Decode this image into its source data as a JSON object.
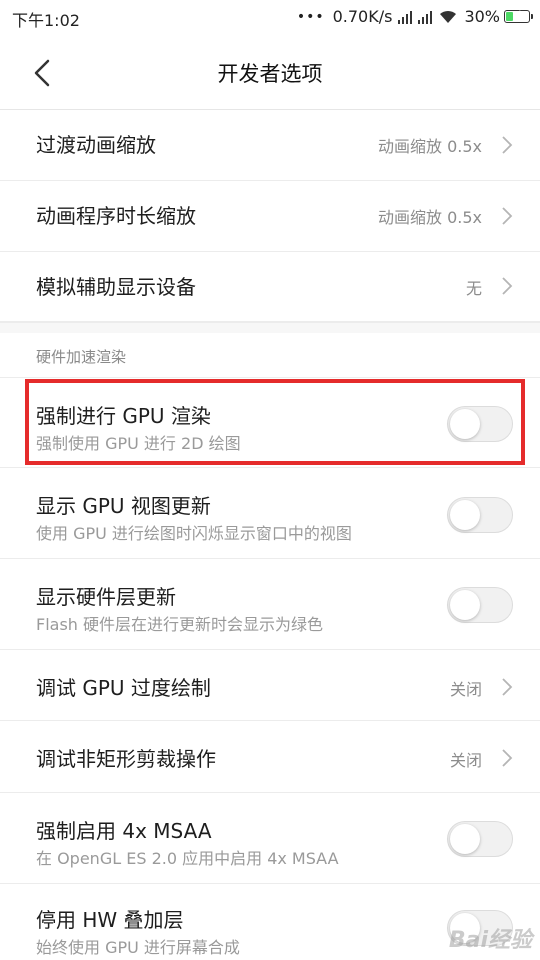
{
  "status": {
    "time": "下午1:02",
    "dots": "•••",
    "network_speed": "0.70K/s",
    "battery": "30%",
    "battery_level": 0.3,
    "battery_fill_color": "#4cd964"
  },
  "header": {
    "title": "开发者选项",
    "back_icon": "chevron-left-icon"
  },
  "rows_top": [
    {
      "title": "过渡动画缩放",
      "value": "动画缩放 0.5x"
    },
    {
      "title": "动画程序时长缩放",
      "value": "动画缩放 0.5x"
    },
    {
      "title": "模拟辅助显示设备",
      "value": "无"
    }
  ],
  "section": {
    "label": "硬件加速渲染"
  },
  "rows": [
    {
      "title": "强制进行 GPU 渲染",
      "subtitle": "强制使用 GPU 进行 2D 绘图",
      "control": "toggle",
      "on": false
    },
    {
      "title": "显示 GPU 视图更新",
      "subtitle": "使用 GPU 进行绘图时闪烁显示窗口中的视图",
      "control": "toggle",
      "on": false
    },
    {
      "title": "显示硬件层更新",
      "subtitle": "Flash 硬件层在进行更新时会显示为绿色",
      "control": "toggle",
      "on": false
    },
    {
      "title": "调试 GPU 过度绘制",
      "value": "关闭",
      "control": "chevron"
    },
    {
      "title": "调试非矩形剪裁操作",
      "value": "关闭",
      "control": "chevron"
    },
    {
      "title": "强制启用 4x MSAA",
      "subtitle": "在 OpenGL ES 2.0 应用中启用 4x MSAA",
      "control": "toggle",
      "on": false
    },
    {
      "title": "停用 HW 叠加层",
      "subtitle": "始终使用 GPU 进行屏幕合成",
      "control": "toggle",
      "on": false
    }
  ],
  "highlight_color": "#e52b2b",
  "watermark": "Bai经验"
}
